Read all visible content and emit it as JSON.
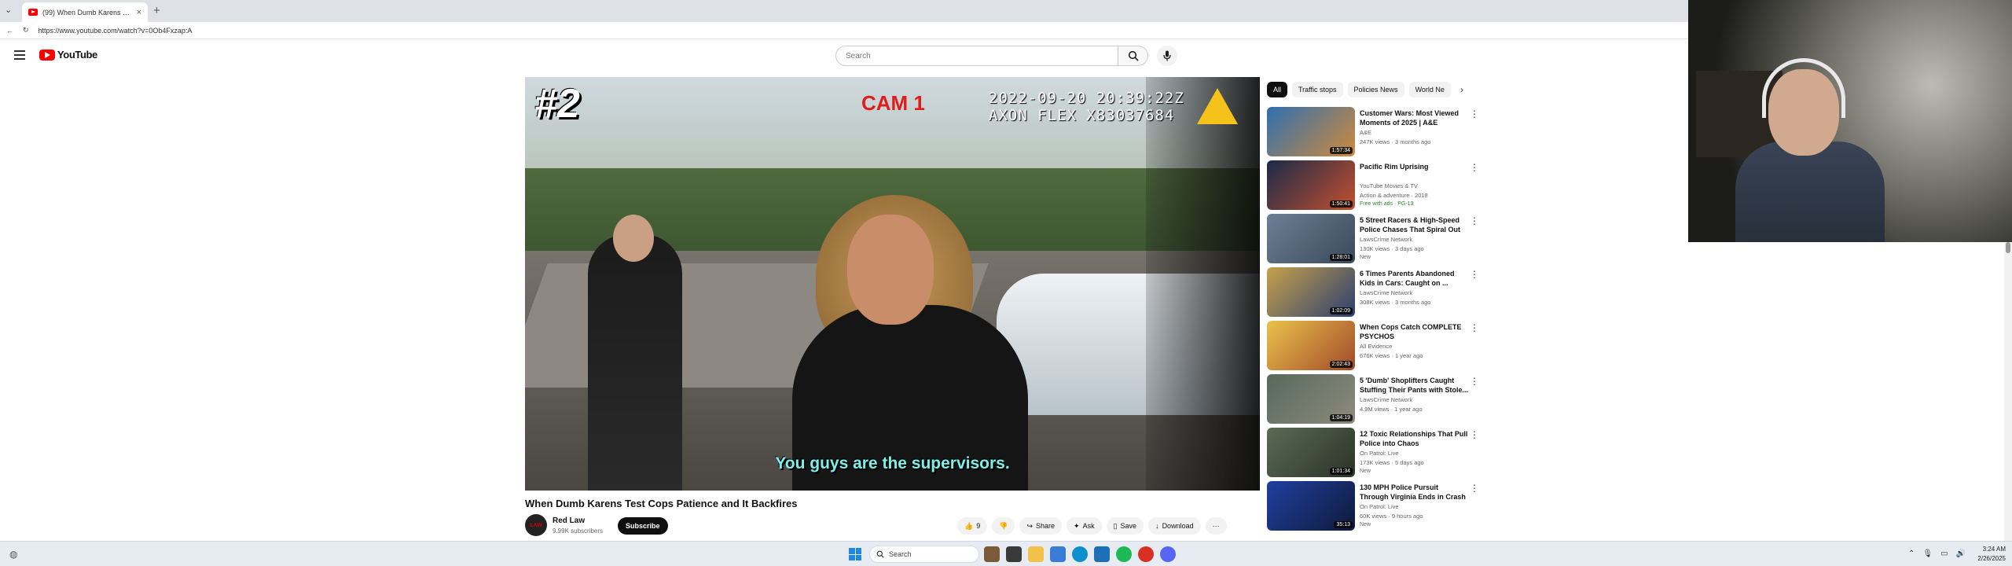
{
  "browser": {
    "tab_title": "(99) When Dumb Karens Tes",
    "tab_close": "×",
    "new_tab": "+",
    "url": "https://www.youtube.com/watch?v=0Ob4Fxzap:A"
  },
  "youtube": {
    "logo_text": "YouTube",
    "search_placeholder": "Search"
  },
  "video": {
    "overlay_number": "#2",
    "overlay_cam": "CAM 1",
    "overlay_timestamp": "2022-09-20 20:39:22Z",
    "overlay_device": "AXON FLEX X83037684",
    "caption": "You guys are the supervisors.",
    "title": "When Dumb Karens Test Cops Patience and It Backfires",
    "channel_name": "Red Law",
    "channel_avatar_text": "LAW",
    "channel_subs": "9.99K subscribers",
    "subscribe_label": "Subscribe",
    "actions": {
      "like_count": "9",
      "share": "Share",
      "ask": "Ask",
      "save": "Save",
      "download": "Download",
      "more": "···"
    }
  },
  "chips": [
    "All",
    "Traffic stops",
    "Policies News",
    "World Ne"
  ],
  "recommendations": [
    {
      "title": "Customer Wars: Most Viewed Moments of 2025 | A&E",
      "channel": "A&E",
      "meta": "247K views · 3 months ago",
      "extra": "",
      "duration": "1:57:34",
      "color1": "#2f6fb0",
      "color2": "#d08a3a"
    },
    {
      "title": "Pacific Rim Uprising",
      "channel": "YouTube Movies & TV",
      "meta": "Action & adventure · 2018",
      "extra": "Free with ads · PG-13",
      "duration": "1:50:41",
      "color1": "#1a2a4a",
      "color2": "#c4502e"
    },
    {
      "title": "5 Street Racers & High-Speed Police Chases That Spiral Out ...",
      "channel": "LawsCrime Network",
      "meta": "130K views · 3 days ago",
      "extra": "New",
      "duration": "1:28:01",
      "color1": "#6d7f95",
      "color2": "#3a4a5a"
    },
    {
      "title": "6 Times Parents Abandoned Kids in Cars: Caught on ...",
      "channel": "LawsCrime Network",
      "meta": "308K views · 3 months ago",
      "extra": "",
      "duration": "1:02:09",
      "color1": "#c6a14c",
      "color2": "#2c3f70"
    },
    {
      "title": "When Cops Catch COMPLETE PSYCHOS",
      "channel": "All Evidence",
      "meta": "676K views · 1 year ago",
      "extra": "",
      "duration": "2:02:43",
      "color1": "#e9c24b",
      "color2": "#a14a2a"
    },
    {
      "title": "5 'Dumb' Shoplifters Caught Stuffing Their Pants with Stole...",
      "channel": "LawsCrime Network",
      "meta": "4.9M views · 1 year ago",
      "extra": "",
      "duration": "1:04:19",
      "color1": "#566a5c",
      "color2": "#8e8a7e"
    },
    {
      "title": "12 Toxic Relationships That Pull Police into Chaos",
      "channel": "On Patrol: Live",
      "meta": "173K views · 5 days ago",
      "extra": "New",
      "duration": "1:01:34",
      "color1": "#5b6a55",
      "color2": "#2a3328"
    },
    {
      "title": "130 MPH Police Pursuit Through Virginia Ends in Crash",
      "channel": "On Patrol: Live",
      "meta": "60K views · 9 hours ago",
      "extra": "New",
      "duration": "35:13",
      "color1": "#2040a0",
      "color2": "#0e1a3a"
    }
  ],
  "taskbar": {
    "search_label": "Search",
    "time": "3:24 AM",
    "date": "2/26/2025"
  }
}
